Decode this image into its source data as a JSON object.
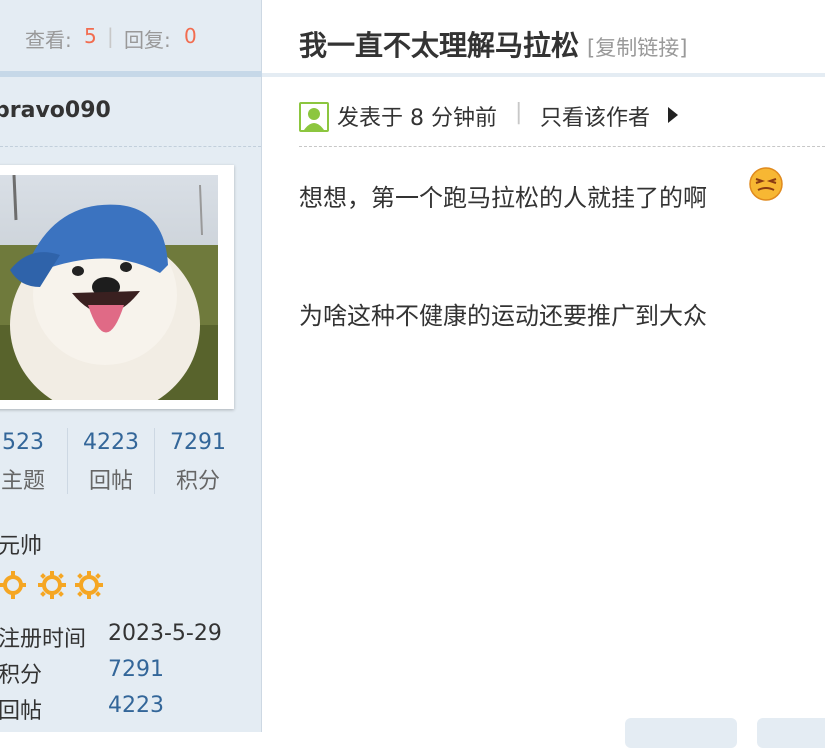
{
  "stats": {
    "views_label": "查看:",
    "views_value": "5",
    "sep": "|",
    "replies_label": "回复:",
    "replies_value": "0"
  },
  "user": {
    "name": "bravo090",
    "avatar": "dog-wearing-blue-hat-avatar",
    "counts": [
      {
        "number": "523",
        "label": "主题"
      },
      {
        "number": "4223",
        "label": "回帖"
      },
      {
        "number": "7291",
        "label": "积分"
      }
    ],
    "rank": "元帅",
    "star_count": 3,
    "info": [
      {
        "key": "注册时间",
        "value": "2023-5-29"
      },
      {
        "key": "积分",
        "value": "7291"
      },
      {
        "key": "回帖",
        "value": "4223"
      }
    ]
  },
  "post": {
    "title": "我一直不太理解马拉松",
    "copy_link": "[复制链接]",
    "posted": "发表于 8 分钟前",
    "meta_sep": "|",
    "only_author": "只看该作者",
    "paragraphs": [
      "想想，第一个跑马拉松的人就挂了的啊",
      "为啥这种不健康的运动还要推广到大众"
    ],
    "emoji": "dizzy-face-emoji"
  },
  "colors": {
    "sidebar_bg": "#e4ecf3",
    "accent_orange": "#f26c4f",
    "link_blue": "#336699",
    "star_orange": "#f5a623"
  }
}
